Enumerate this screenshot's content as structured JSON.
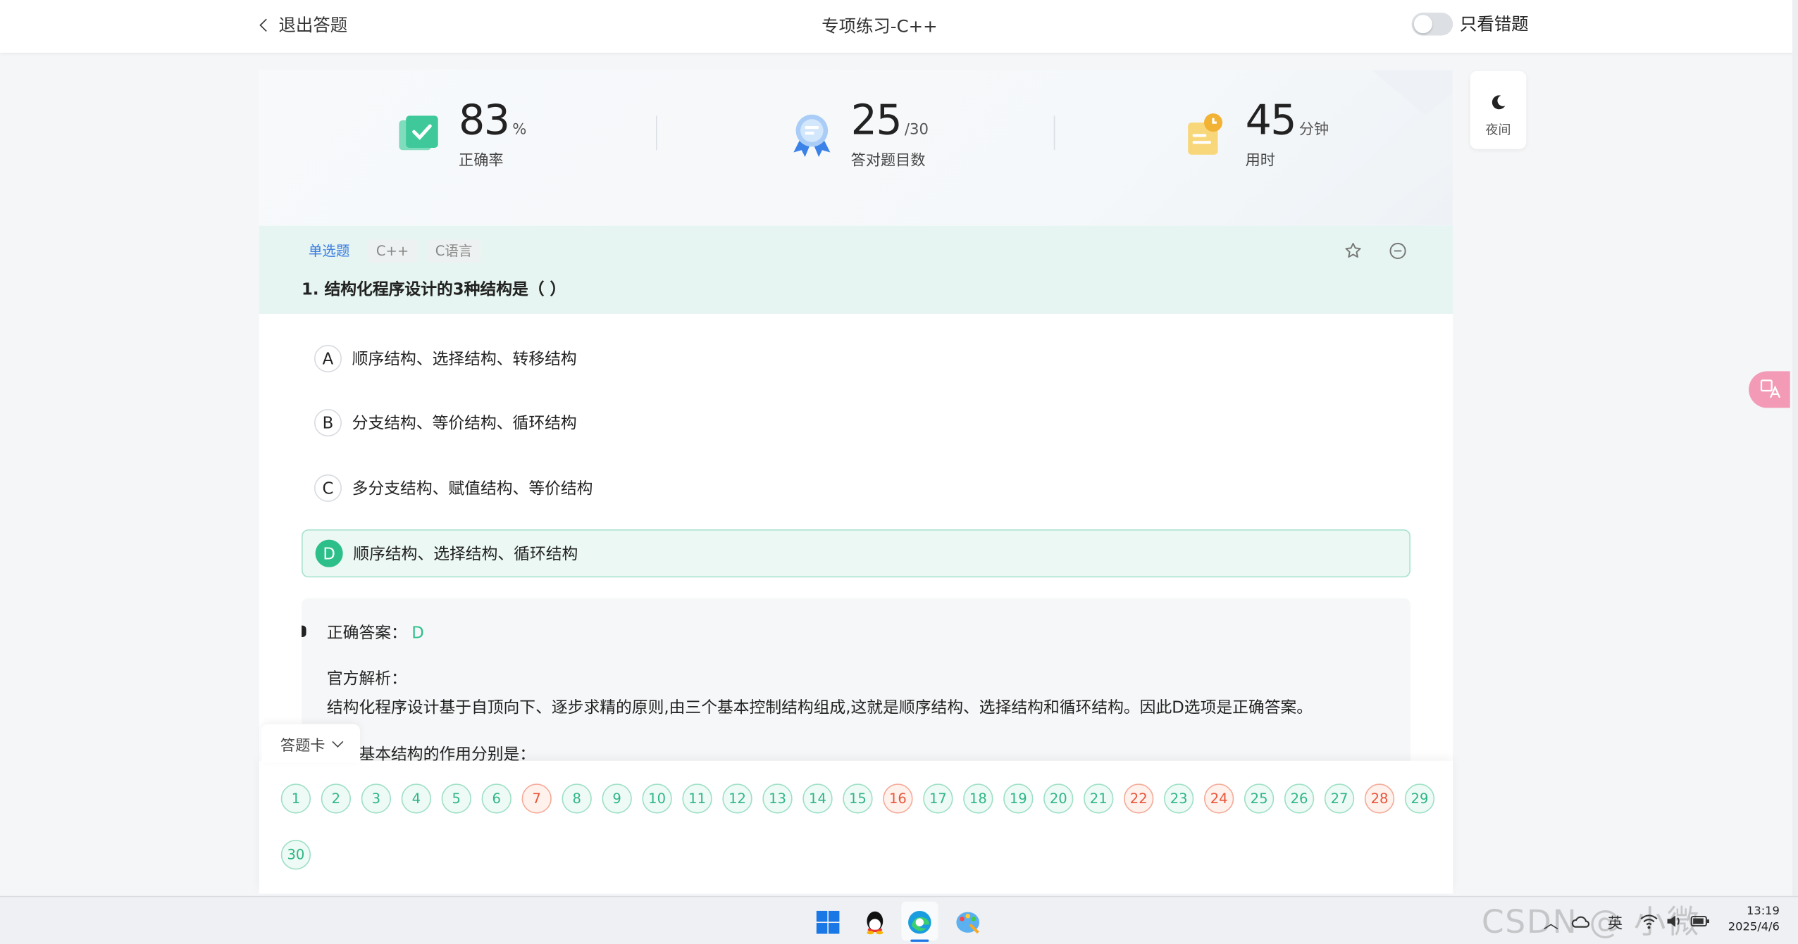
{
  "header": {
    "back_label": "退出答题",
    "title": "专项练习-C++",
    "toggle_label": "只看错题"
  },
  "stats": [
    {
      "value": "83",
      "unit": "%",
      "label": "正确率"
    },
    {
      "value": "25",
      "unit": "/30",
      "label": "答对题目数"
    },
    {
      "value": "45",
      "unit": "分钟",
      "label": "用时"
    }
  ],
  "question": {
    "tags": [
      "单选题",
      "C++",
      "C语言"
    ],
    "text": "1. 结构化程序设计的3种结构是（ ）",
    "options": [
      {
        "letter": "A",
        "text": "顺序结构、选择结构、转移结构"
      },
      {
        "letter": "B",
        "text": "分支结构、等价结构、循环结构"
      },
      {
        "letter": "C",
        "text": "多分支结构、赋值结构、等价结构"
      },
      {
        "letter": "D",
        "text": "顺序结构、选择结构、循环结构"
      }
    ],
    "selected": "D"
  },
  "answer": {
    "correct_label": "正确答案：",
    "correct_value": "D",
    "analysis_heading": "官方解析：",
    "analysis_text": "结构化程序设计基于自顶向下、逐步求精的原则,由三个基本控制结构组成,这就是顺序结构、选择结构和循环结构。因此D选项是正确答案。",
    "analysis_more": "三种基本结构的作用分别是："
  },
  "sheet": {
    "tab_label": "答题卡",
    "numbers": [
      "1",
      "2",
      "3",
      "4",
      "5",
      "6",
      "7",
      "8",
      "9",
      "10",
      "11",
      "12",
      "13",
      "14",
      "15",
      "16",
      "17",
      "18",
      "19",
      "20",
      "21",
      "22",
      "23",
      "24",
      "25",
      "26",
      "27",
      "28",
      "29",
      "30"
    ],
    "wrong": [
      "7",
      "16",
      "22",
      "24",
      "28"
    ]
  },
  "side": {
    "night_label": "夜间"
  },
  "taskbar": {
    "ime": "英",
    "time": "13:19",
    "date": "2025/4/6",
    "watermark": "CSDN @ 小微"
  },
  "colors": {
    "accent": "#2dbf8a",
    "wrong": "#e8553a",
    "question_bg": "#e6f5f1"
  }
}
